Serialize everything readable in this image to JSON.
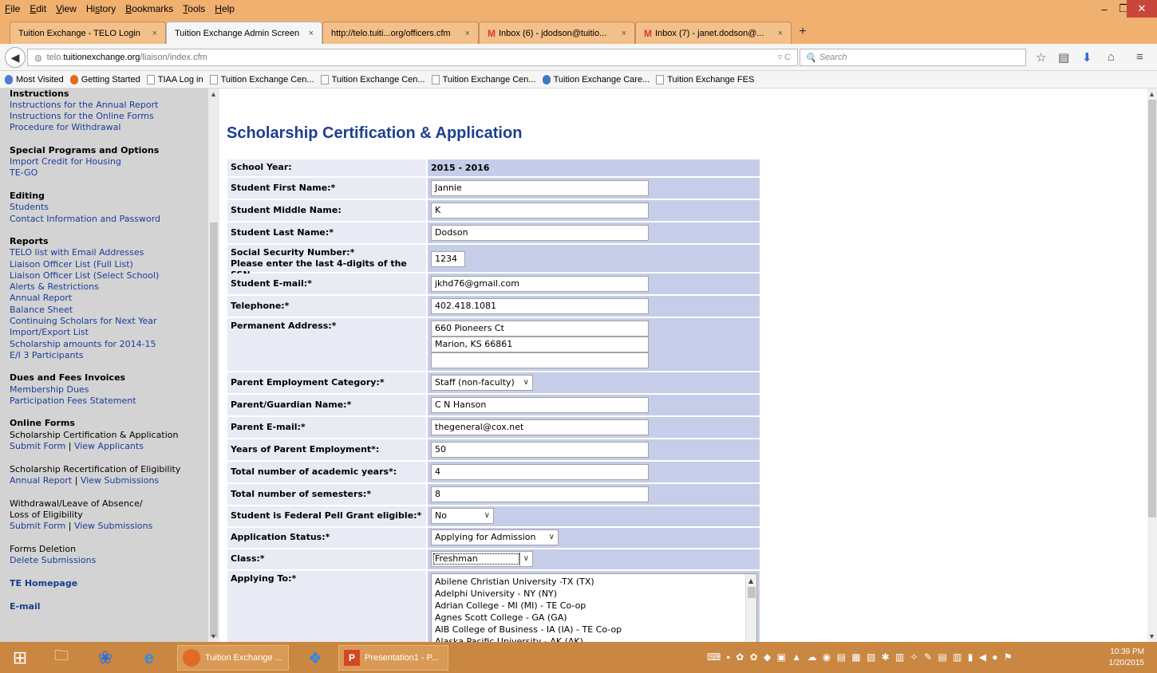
{
  "menubar": {
    "items": [
      {
        "label": "File",
        "u": "F"
      },
      {
        "label": "Edit",
        "u": "E"
      },
      {
        "label": "View",
        "u": "V"
      },
      {
        "label": "History",
        "u": "s"
      },
      {
        "label": "Bookmarks",
        "u": "B"
      },
      {
        "label": "Tools",
        "u": "T"
      },
      {
        "label": "Help",
        "u": "H"
      }
    ]
  },
  "tabs": [
    {
      "label": "Tuition Exchange - TELO Login",
      "active": false,
      "icon": "none"
    },
    {
      "label": "Tuition Exchange Admin Screen",
      "active": true,
      "icon": "none"
    },
    {
      "label": "http://telo.tuiti...org/officers.cfm",
      "active": false,
      "icon": "none"
    },
    {
      "label": "Inbox (6) - jdodson@tuitio...",
      "active": false,
      "icon": "gmail-icon"
    },
    {
      "label": "Inbox (7) - janet.dodson@...",
      "active": false,
      "icon": "gmail-icon"
    }
  ],
  "tab_close_glyph": "×",
  "newtab_glyph": "+",
  "url": {
    "prefix": "telo.",
    "domain": "tuitionexchange.org",
    "path": "/liaison/index.cfm"
  },
  "search_placeholder": "Search",
  "bookmarks": [
    {
      "label": "Most Visited",
      "icon": "round"
    },
    {
      "label": "Getting Started",
      "icon": "fox"
    },
    {
      "label": "TIAA Log in",
      "icon": "page"
    },
    {
      "label": "Tuition Exchange Cen...",
      "icon": "page"
    },
    {
      "label": "Tuition Exchange Cen...",
      "icon": "page"
    },
    {
      "label": "Tuition Exchange Cen...",
      "icon": "page"
    },
    {
      "label": "Tuition Exchange Care...",
      "icon": "te"
    },
    {
      "label": "Tuition Exchange FES",
      "icon": "page"
    }
  ],
  "sidebar": {
    "instructions_head": "Instructions",
    "instr_annual": "Instructions for the Annual Report",
    "instr_online": "Instructions for the Online Forms",
    "withdrawal_proc": "Procedure for Withdrawal",
    "special_head": "Special Programs and Options",
    "import_credit": "Import Credit for Housing",
    "tego": "TE-GO",
    "editing_head": "Editing",
    "students": "Students",
    "contact_info": "Contact Information and Password",
    "reports_head": "Reports",
    "telo_list": "TELO list with Email Addresses",
    "liaison_full": "Liaison Officer List (Full List)",
    "liaison_select": "Liaison Officer List (Select School)",
    "alerts": "Alerts & Restrictions",
    "annual_report": "Annual Report",
    "balance_sheet": "Balance Sheet",
    "continuing": "Continuing Scholars for Next Year",
    "import_export": "Import/Export List",
    "scholarship_amounts": "Scholarship amounts for 2014-15",
    "ei3": "E/I 3 Participants",
    "dues_head": "Dues and Fees Invoices",
    "membership_dues": "Membership Dues",
    "participation_fees": "Participation Fees Statement",
    "online_forms_head": "Online Forms",
    "sca_label": "Scholarship Certification & Application",
    "submit_form": "Submit Form",
    "pipe": " | ",
    "view_applicants": "View Applicants",
    "recert_label": "Scholarship Recertification of Eligibility",
    "annual_report2": "Annual Report",
    "view_submissions": "View Submissions",
    "withdrawal_label1": "Withdrawal/Leave of Absence/",
    "withdrawal_label2": "Loss of Eligibility",
    "submit_form2": "Submit Form",
    "view_submissions2": "View Submissions",
    "forms_deletion": "Forms Deletion",
    "delete_submissions": "Delete Submissions",
    "te_homepage": "TE Homepage",
    "email": "E-mail"
  },
  "form": {
    "title": "Scholarship Certification & Application",
    "school_year_label": "School Year:",
    "school_year_value": "2015 - 2016",
    "first_name_label": "Student First Name:*",
    "first_name": "Jannie",
    "middle_name_label": "Student Middle Name:",
    "middle_name": "K",
    "last_name_label": "Student Last Name:*",
    "last_name": "Dodson",
    "ssn_label1": "Social Security Number:*",
    "ssn_label2": "Please enter the last 4-digits of the SSN.",
    "ssn": "1234",
    "email_label": "Student E-mail:*",
    "email": "jkhd76@gmail.com",
    "phone_label": "Telephone:*",
    "phone": "402.418.1081",
    "address_label": "Permanent Address:*",
    "address1": "660 Pioneers  Ct",
    "address2": "Marion, KS  66861",
    "address3": "",
    "emp_cat_label": "Parent Employment Category:*",
    "emp_cat": "Staff (non-faculty)",
    "guardian_label": "Parent/Guardian Name:*",
    "guardian": "C N Hanson",
    "parent_email_label": "Parent E-mail:*",
    "parent_email": "thegeneral@cox.net",
    "years_emp_label": "Years of Parent Employment*:",
    "years_emp": "50",
    "academic_years_label": "Total number of academic years*:",
    "academic_years": "4",
    "semesters_label": "Total number of semesters:*",
    "semesters": "8",
    "pell_label": "Student is Federal Pell Grant eligible:*",
    "pell": "No",
    "app_status_label": "Application Status:*",
    "app_status": "Applying for Admission",
    "class_label": "Class:*",
    "class_value": "Freshman",
    "applying_label": "Applying To:*",
    "applying_options": [
      "Abilene Christian University -TX (TX)",
      "Adelphi University - NY (NY)",
      "Adrian College - MI (MI) - TE Co-op",
      "Agnes Scott College - GA (GA)",
      "AIB College of Business - IA (IA) - TE Co-op",
      "Alaska Pacific University - AK (AK)"
    ]
  },
  "taskbar": {
    "firefox_label": "Tuition Exchange ...",
    "ppt_label": "Presentation1 - P...",
    "ppt_icon_text": "P",
    "time": "10:39 PM",
    "date": "1/20/2015"
  }
}
